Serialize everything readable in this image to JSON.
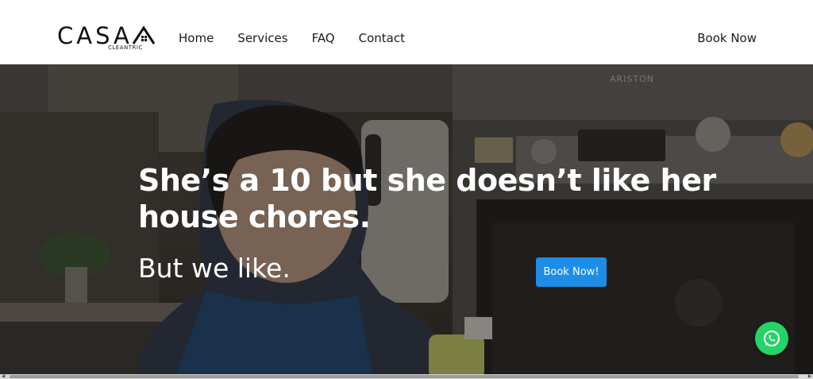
{
  "header": {
    "logo_text": "CASA",
    "logo_sub": "CLEANTRIC",
    "nav": [
      {
        "label": "Home"
      },
      {
        "label": "Services"
      },
      {
        "label": "FAQ"
      },
      {
        "label": "Contact"
      }
    ],
    "cta_label": "Book Now"
  },
  "hero": {
    "headline": "She’s a 10 but she doesn’t like her house chores.",
    "subline": "But we like.",
    "button_label": "Book Now!",
    "oven_brand": "ARISTON"
  },
  "colors": {
    "accent": "#1d8de8",
    "whatsapp": "#25d366",
    "header_bg": "#ffffff",
    "text_dark": "#1a1a1a"
  },
  "icons": {
    "whatsapp": "whatsapp-icon",
    "logo_house": "house-icon"
  }
}
